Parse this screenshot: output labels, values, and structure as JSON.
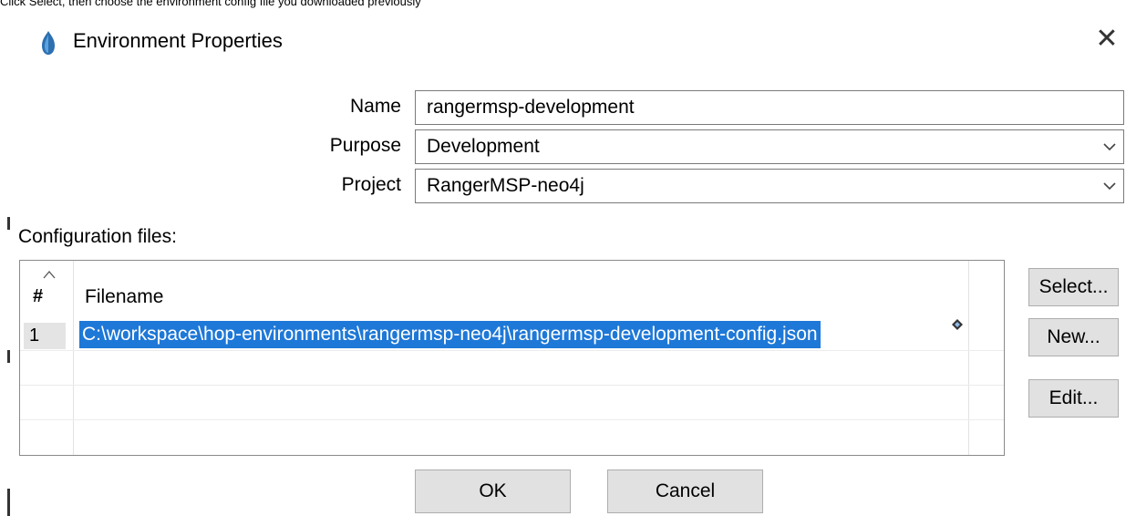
{
  "caption": "Click Select, then choose the environment config file you downloaded previously",
  "dialog": {
    "title": "Environment Properties",
    "close_glyph": "✕",
    "icon": "hop-logo-icon",
    "accent_color": "#1e78d7"
  },
  "form": {
    "name_label": "Name",
    "name_value": "rangermsp-development",
    "purpose_label": "Purpose",
    "purpose_value": "Development",
    "project_label": "Project",
    "project_value": "RangerMSP-neo4j"
  },
  "config": {
    "section_label": "Configuration files:",
    "columns": [
      "#",
      "Filename"
    ],
    "rows": [
      {
        "num": "1",
        "filename": "C:\\workspace\\hop-environments\\rangermsp-neo4j\\rangermsp-development-config.json"
      }
    ],
    "buttons": {
      "select": "Select...",
      "new": "New...",
      "edit": "Edit..."
    }
  },
  "footer": {
    "ok": "OK",
    "cancel": "Cancel"
  }
}
